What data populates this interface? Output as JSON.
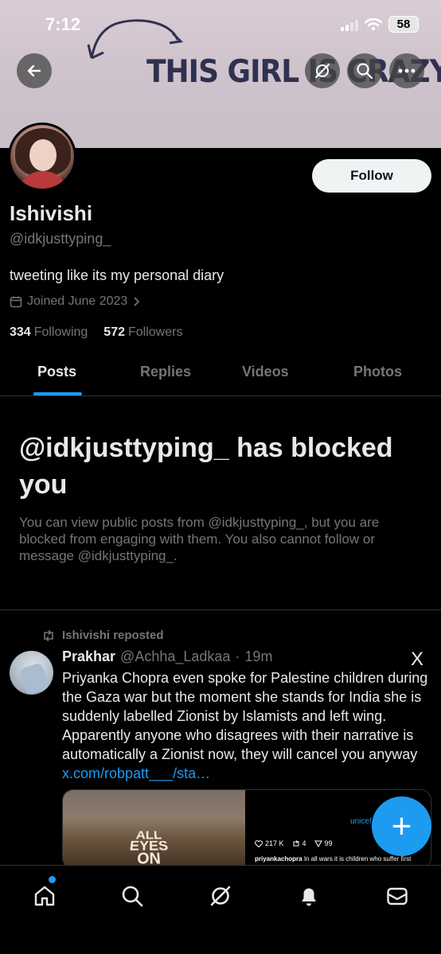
{
  "status_bar": {
    "time": "7:12",
    "battery": "58"
  },
  "banner": {
    "text": "THIS GIRL IS CRAZY!"
  },
  "profile": {
    "follow_label": "Follow",
    "name": "Ishivishi",
    "handle": "@idkjusttyping_",
    "bio": "tweeting like its my personal diary",
    "joined": "Joined June 2023",
    "following_count": "334",
    "following_label": "Following",
    "followers_count": "572",
    "followers_label": "Followers"
  },
  "tabs": [
    {
      "label": "Posts",
      "active": true
    },
    {
      "label": "Replies"
    },
    {
      "label": "Videos"
    },
    {
      "label": "Photos"
    }
  ],
  "blocked": {
    "title": "@idkjusttyping_ has blocked you",
    "description": "You can view public posts from @idkjusttyping_, but you are blocked from engaging with them. You also cannot follow or message @idkjusttyping_."
  },
  "post": {
    "repost_label": "Ishivishi reposted",
    "author_name": "Prakhar",
    "author_handle": "@Achha_Ladkaa",
    "separator": "·",
    "time": "19m",
    "source_logo": "X",
    "text": "Priyanka Chopra even spoke for Palestine children during the Gaza war but the moment she stands for India she is suddenly labelled Zionist by Islamists and left wing. Apparently anyone who disagrees with their narrative is automatically a Zionist now, they will cancel you anyway ",
    "link": "x.com/robpatt___/sta…",
    "media": {
      "left_text_line1": "ALL",
      "left_text_line2": "EYES",
      "left_text_line3": "ON",
      "right_brand": "unicef",
      "likes": "217 K",
      "reposts": "4",
      "shares": "99",
      "caption_user": "priyankachopra",
      "caption_text": "In all wars it is children who suffer first"
    }
  },
  "fab_label": "+",
  "bottom_nav": [
    "home-icon",
    "search-icon",
    "grok-icon",
    "notifications-icon",
    "messages-icon"
  ],
  "colors": {
    "accent": "#1d9bf0",
    "background": "#000000",
    "muted": "#71767b"
  }
}
